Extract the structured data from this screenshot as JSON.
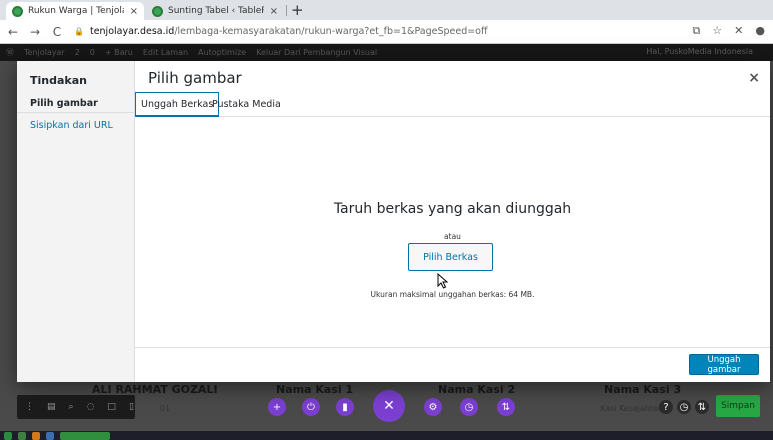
{
  "browser": {
    "tabs": [
      {
        "title": "Rukun Warga | Tenjolayar",
        "close": "×"
      },
      {
        "title": "Sunting Tabel ‹ TablePress ‹ T",
        "close": "×"
      }
    ],
    "new_tab": "+",
    "url_host": "tenjolayar.desa.id",
    "url_path": "/lembaga-kemasyarakatan/rukun-warga?et_fb=1&PageSpeed=off"
  },
  "adminbar": {
    "items": [
      "Tenjolayar",
      "2",
      "0",
      "+ Baru",
      "Edit Laman",
      "Autoptimize",
      "Keluar Dari Pembangun Visual"
    ],
    "greeting": "Hai, PuskoMedia Indonesia"
  },
  "background": {
    "names": [
      "ALI RAHMAT GOZALI",
      "Nama Kasi 1",
      "Nama Kasi 2",
      "Nama Kasi 3"
    ],
    "sub_left": "01",
    "sub_right": "Kasi Kesejahtera",
    "save_label": "Simpan"
  },
  "modal": {
    "menu_title": "Tindakan",
    "menu_current": "Pilih gambar",
    "menu_link": "Sisipkan dari URL",
    "title": "Pilih gambar",
    "close": "×",
    "tabs": [
      "Unggah Berkas",
      "Pustaka Media"
    ],
    "drop_instructions": "Taruh berkas yang akan diunggah",
    "or_text": "atau",
    "select_button": "Pilih Berkas",
    "max_size": "Ukuran maksimal unggahan berkas: 64 MB.",
    "primary_button": "Unggah gambar"
  },
  "colors": {
    "accent": "#0073aa",
    "primary": "#0085ba",
    "save_green": "#27a844"
  }
}
